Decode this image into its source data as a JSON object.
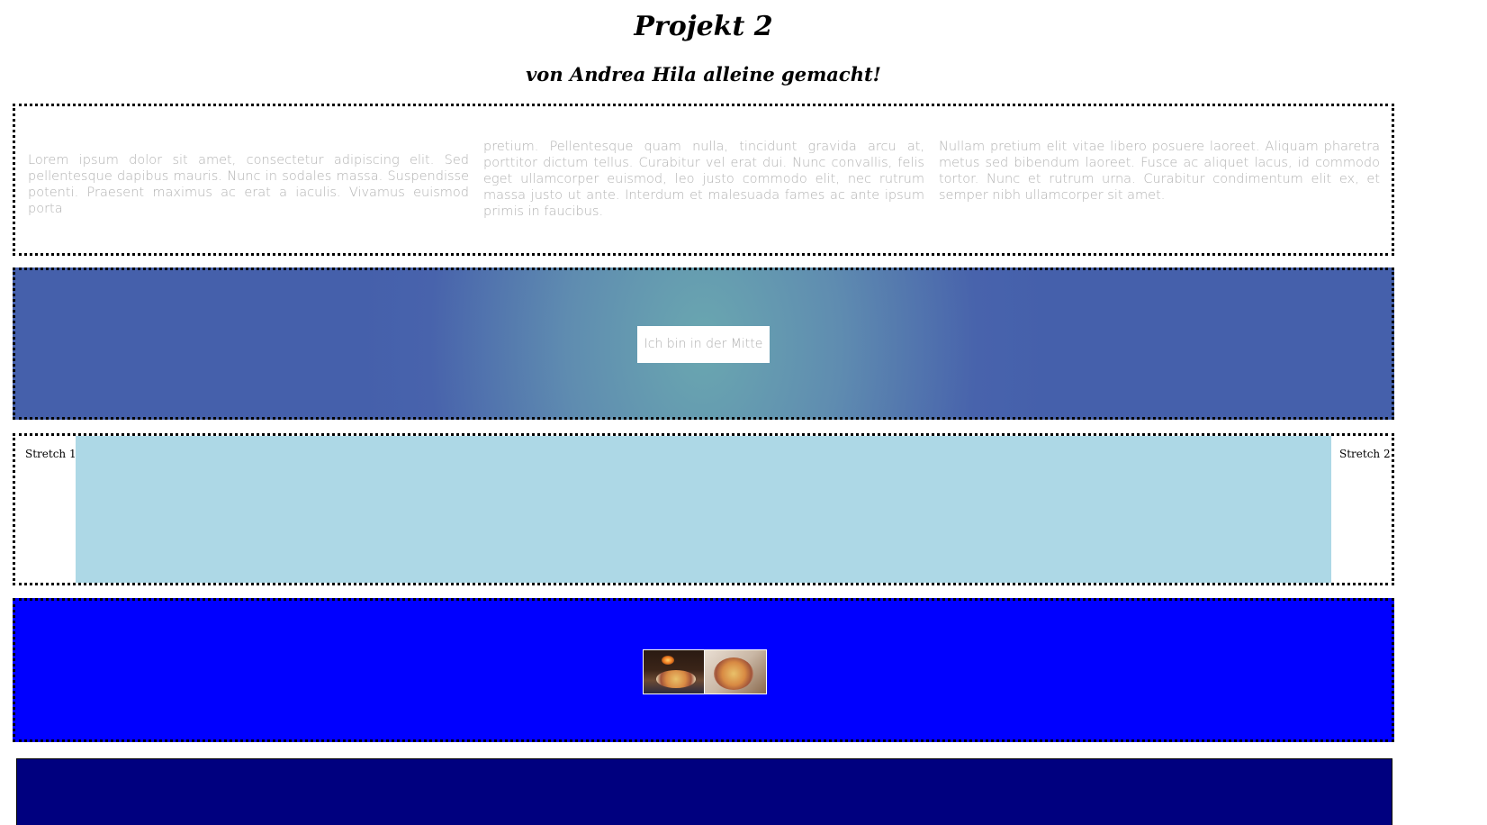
{
  "header": {
    "title": "Projekt 2",
    "subtitle": "von Andrea Hila alleine gemacht!"
  },
  "text_section": {
    "columns": [
      "Lorem ipsum dolor sit amet, consectetur adipiscing elit. Sed pellentesque dapibus mauris. Nunc in sodales massa. Suspendisse potenti. Praesent maximus ac erat a iaculis. Vivamus euismod porta",
      "pretium. Pellentesque quam nulla, tincidunt gravida arcu at, porttitor dictum tellus. Curabitur vel erat dui. Nunc convallis, felis eget ullamcorper euismod, leo justo commodo elit, nec rutrum massa justo ut ante. Interdum et malesuada fames ac ante ipsum primis in faucibus.",
      "Nullam pretium elit vitae libero posuere laoreet. Aliquam pharetra metus sed bibendum laoreet. Fusce ac aliquet lacus, id commodo tortor. Nunc et rutrum urna. Curabitur condimentum elit ex, et semper nibh ullamcorper sit amet."
    ]
  },
  "center_section": {
    "box_text": "Ich bin in der Mitte",
    "colors": {
      "center": "#6aa7b0",
      "edge": "#4560ab"
    }
  },
  "stretch_section": {
    "left_label": "Stretch 1",
    "right_label": "Stretch 2",
    "fill_color": "#add8e6"
  },
  "image_section": {
    "background": "#0000ff",
    "images": [
      "pizza-oven-image",
      "pizza-slice-image"
    ]
  },
  "footer": {
    "color": "#00007f"
  }
}
